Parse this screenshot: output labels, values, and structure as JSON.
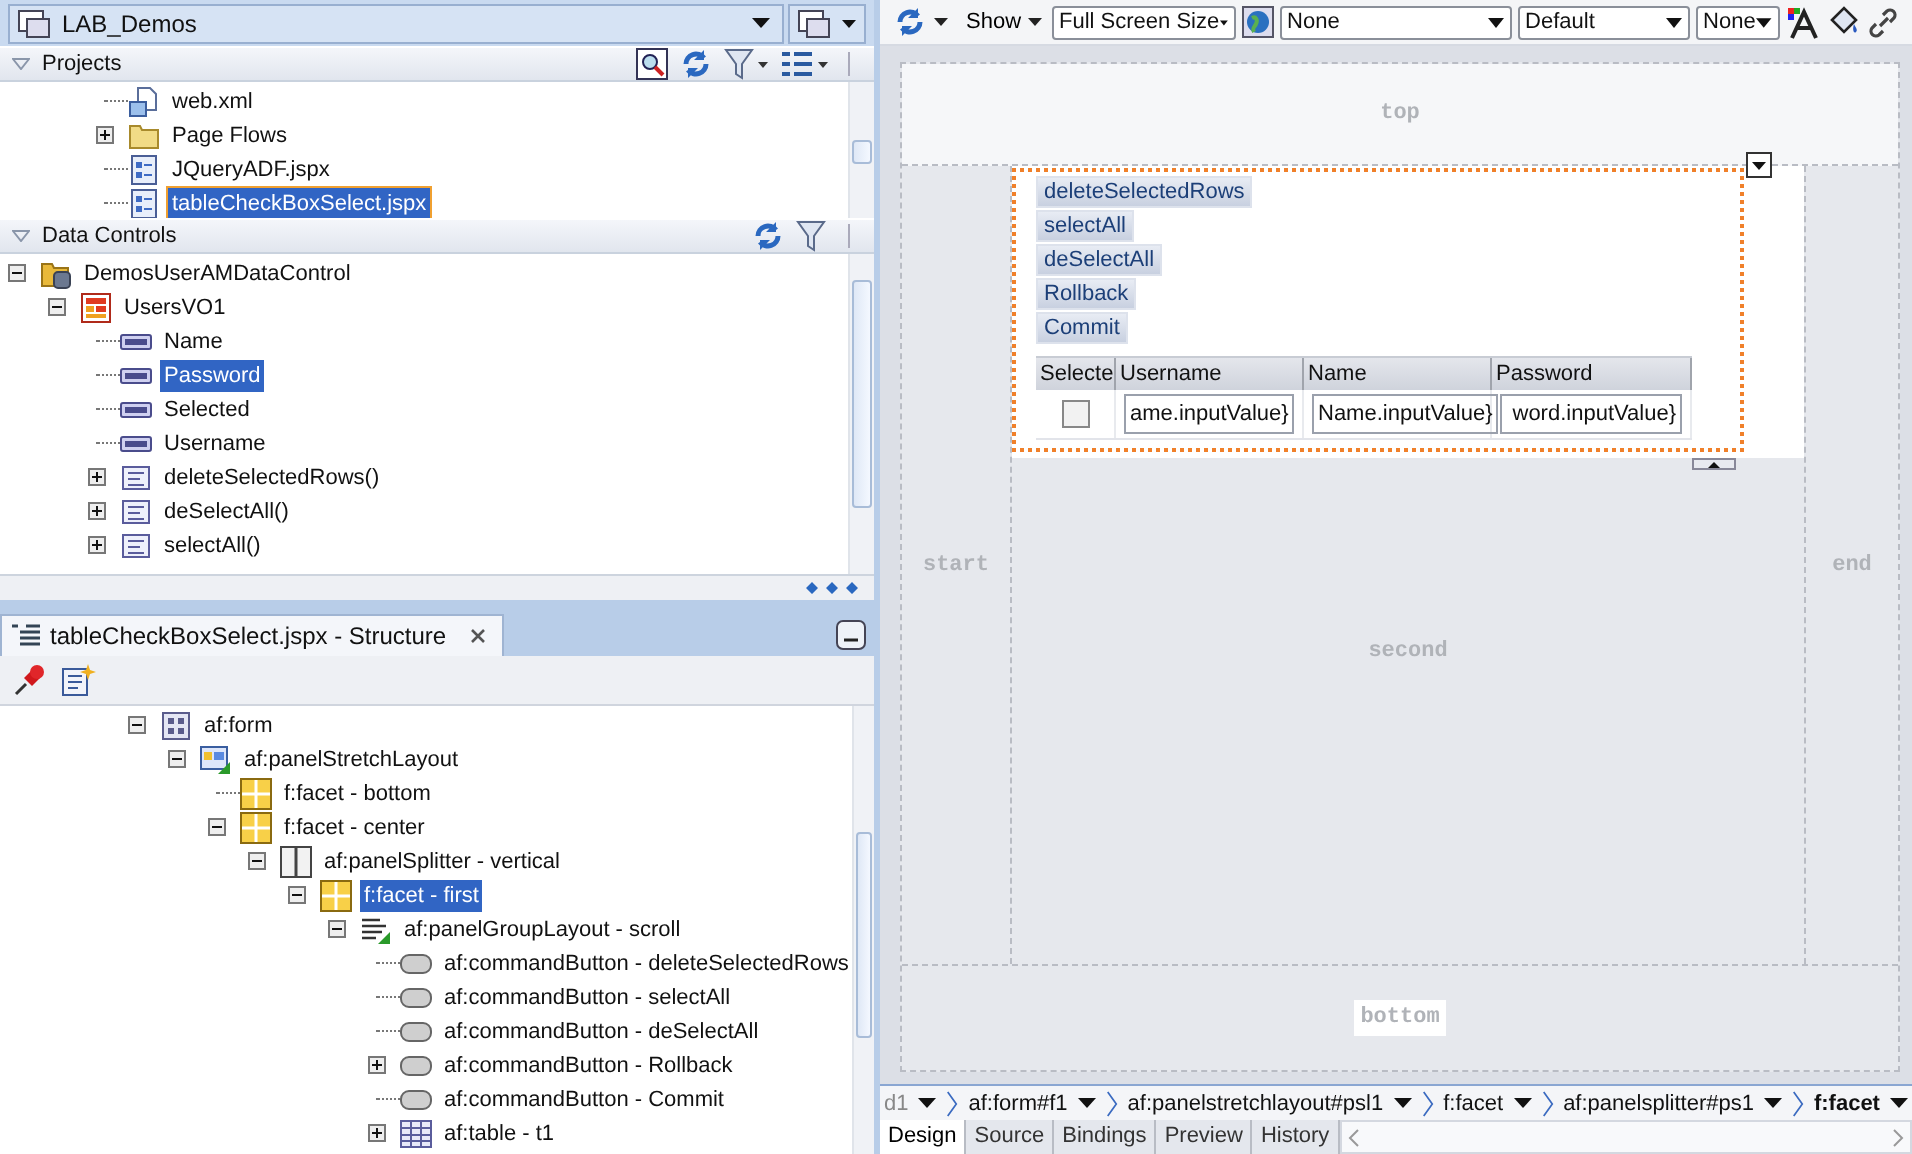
{
  "app_selector": {
    "value": "LAB_Demos"
  },
  "projects": {
    "title": "Projects",
    "tree": [
      {
        "label": "web.xml",
        "kind": "file",
        "selected": false
      },
      {
        "label": "Page Flows",
        "kind": "folder",
        "expanded": false,
        "selected": false
      },
      {
        "label": "JQueryADF.jspx",
        "kind": "page",
        "selected": false
      },
      {
        "label": "tableCheckBoxSelect.jspx",
        "kind": "page",
        "selected": true
      }
    ]
  },
  "data_controls": {
    "title": "Data Controls",
    "tree": [
      {
        "label": "DemosUserAMDataControl",
        "kind": "datacontrol",
        "expanded": true,
        "selected": false,
        "children": [
          {
            "label": "UsersVO1",
            "kind": "collection",
            "expanded": true,
            "selected": false,
            "children": [
              {
                "label": "Name",
                "kind": "attribute",
                "selected": false
              },
              {
                "label": "Password",
                "kind": "attribute",
                "selected": true
              },
              {
                "label": "Selected",
                "kind": "attribute",
                "selected": false
              },
              {
                "label": "Username",
                "kind": "attribute",
                "selected": false
              },
              {
                "label": "deleteSelectedRows()",
                "kind": "method",
                "expanded": false,
                "selected": false
              },
              {
                "label": "deSelectAll()",
                "kind": "method",
                "expanded": false,
                "selected": false
              },
              {
                "label": "selectAll()",
                "kind": "method",
                "expanded": false,
                "selected": false
              }
            ]
          }
        ]
      }
    ]
  },
  "structure": {
    "title": "tableCheckBoxSelect.jspx - Structure",
    "tree": [
      {
        "label": "af:form",
        "kind": "form",
        "expanded": true,
        "selected": false,
        "children": [
          {
            "label": "af:panelStretchLayout",
            "kind": "layout",
            "expanded": true,
            "selected": false,
            "children": [
              {
                "label": "f:facet - bottom",
                "kind": "facet",
                "selected": false
              },
              {
                "label": "f:facet - center",
                "kind": "facet",
                "expanded": true,
                "selected": false,
                "children": [
                  {
                    "label": "af:panelSplitter - vertical",
                    "kind": "splitter",
                    "expanded": true,
                    "selected": false,
                    "children": [
                      {
                        "label": "f:facet - first",
                        "kind": "facet",
                        "expanded": true,
                        "selected": true,
                        "children": [
                          {
                            "label": "af:panelGroupLayout - scroll",
                            "kind": "group",
                            "expanded": true,
                            "selected": false,
                            "children": [
                              {
                                "label": "af:commandButton - deleteSelectedRows",
                                "kind": "button",
                                "selected": false
                              },
                              {
                                "label": "af:commandButton - selectAll",
                                "kind": "button",
                                "selected": false
                              },
                              {
                                "label": "af:commandButton - deSelectAll",
                                "kind": "button",
                                "selected": false
                              },
                              {
                                "label": "af:commandButton - Rollback",
                                "kind": "button",
                                "expanded": false,
                                "selected": false
                              },
                              {
                                "label": "af:commandButton - Commit",
                                "kind": "button",
                                "selected": false
                              },
                              {
                                "label": "af:table - t1",
                                "kind": "table",
                                "expanded": false,
                                "selected": false
                              }
                            ]
                          }
                        ]
                      }
                    ]
                  }
                ]
              }
            ]
          }
        ]
      }
    ]
  },
  "editor_toolbar": {
    "show": "Show",
    "size": "Full Screen Size",
    "selects": [
      "None",
      "Default",
      "None"
    ]
  },
  "canvas": {
    "top": "top",
    "start": "start",
    "end": "end",
    "second": "second",
    "bottom": "bottom",
    "buttons": [
      "deleteSelectedRows",
      "selectAll",
      "deSelectAll",
      "Rollback",
      "Commit"
    ],
    "table": {
      "columns": [
        "Selecte",
        "Username",
        "Name",
        "Password"
      ],
      "rows": [
        {
          "cells": [
            {
              "kind": "checkbox",
              "checked": false
            },
            {
              "kind": "input",
              "value": "ame.inputValue}"
            },
            {
              "kind": "input",
              "value": "Name.inputValue}"
            },
            {
              "kind": "input",
              "value": "word.inputValue}"
            }
          ]
        }
      ]
    }
  },
  "breadcrumb": [
    {
      "label": "d1",
      "selected": false
    },
    {
      "label": "af:form#f1",
      "selected": false
    },
    {
      "label": "af:panelstretchlayout#psl1",
      "selected": false
    },
    {
      "label": "f:facet",
      "selected": false
    },
    {
      "label": "af:panelsplitter#ps1",
      "selected": false
    },
    {
      "label": "f:facet",
      "selected": true
    }
  ],
  "editor_tabs": [
    {
      "label": "Design",
      "selected": true
    },
    {
      "label": "Source",
      "selected": false
    },
    {
      "label": "Bindings",
      "selected": false
    },
    {
      "label": "Preview",
      "selected": false
    },
    {
      "label": "History",
      "selected": false
    }
  ]
}
